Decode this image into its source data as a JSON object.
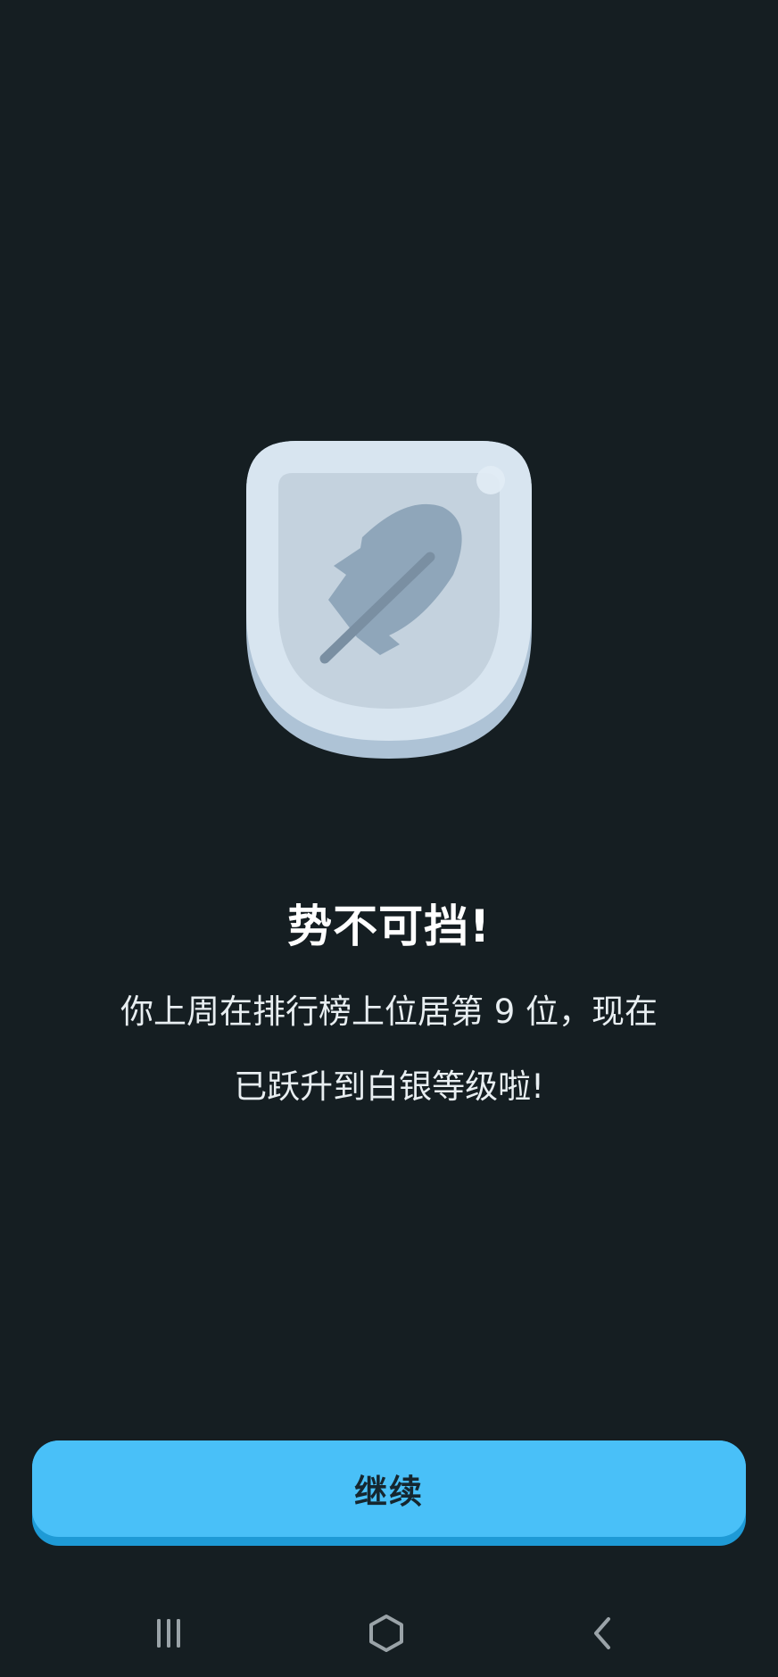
{
  "badge": {
    "icon": "feather-icon",
    "tier_colors": {
      "shield_rim": "#d8e5f0",
      "shield_shadow": "#aec3d6",
      "shield_inner": "#c4d2de",
      "feather": "#8fa6ba",
      "feather_quill": "#7a8fa2"
    }
  },
  "title": "势不可挡!",
  "message_line1": "你上周在排行榜上位居第 9 位，现在",
  "message_line2": "已跃升到白银等级啦!",
  "continue_button": {
    "label": "继续",
    "color": "#49c0f8",
    "shadow_color": "#1e9ad6"
  },
  "nav": {
    "recents_icon": "recents-icon",
    "home_icon": "home-icon",
    "back_icon": "back-icon"
  }
}
